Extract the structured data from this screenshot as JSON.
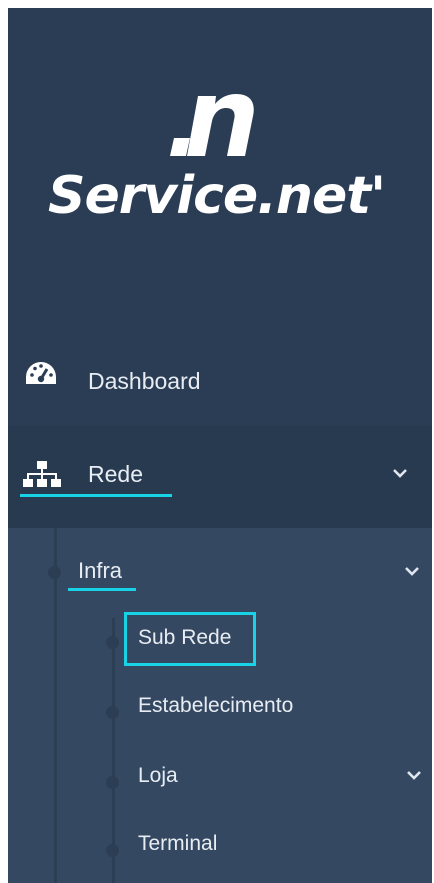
{
  "brand": {
    "logo_text": "Service.net'",
    "logo_mark": ".n"
  },
  "menu": {
    "dashboard": {
      "label": "Dashboard",
      "icon": "gauge-icon"
    },
    "rede": {
      "label": "Rede",
      "icon": "sitemap-icon"
    }
  },
  "submenu": {
    "infra": {
      "label": "Infra"
    },
    "items": [
      {
        "label": "Sub Rede"
      },
      {
        "label": "Estabelecimento"
      },
      {
        "label": "Loja"
      },
      {
        "label": "Terminal"
      }
    ]
  },
  "colors": {
    "sidebar_bg": "#2b3d55",
    "submenu_bg": "#354861",
    "accent": "#18d3e6"
  }
}
